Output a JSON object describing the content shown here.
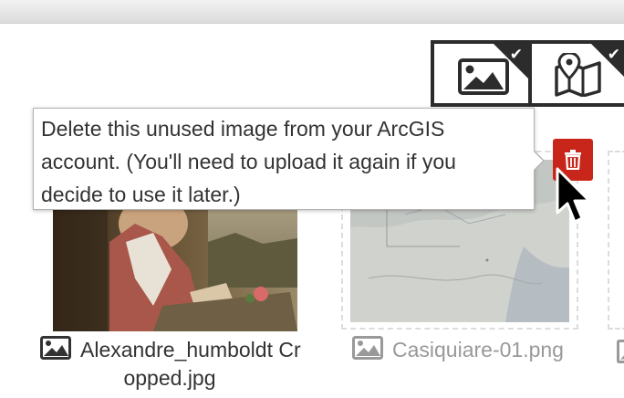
{
  "filters": [
    {
      "name": "images",
      "icon": "image-icon",
      "checked": true
    },
    {
      "name": "maps",
      "icon": "map-icon",
      "checked": true
    }
  ],
  "tooltip": {
    "lines": [
      "Delete this unused image from your ArcGIS",
      "account. (You'll need to upload it again if you",
      "decide to use it later.)"
    ]
  },
  "images": [
    {
      "filename_line1": "Alexandre_humboldt Cr",
      "filename_line2": "opped.jpg",
      "unused": false
    },
    {
      "filename": "Casiquiare-01.png",
      "unused": true
    }
  ],
  "colors": {
    "delete": "#c8261a",
    "filter_border": "#2c2c2c",
    "dim_text": "#999999"
  }
}
